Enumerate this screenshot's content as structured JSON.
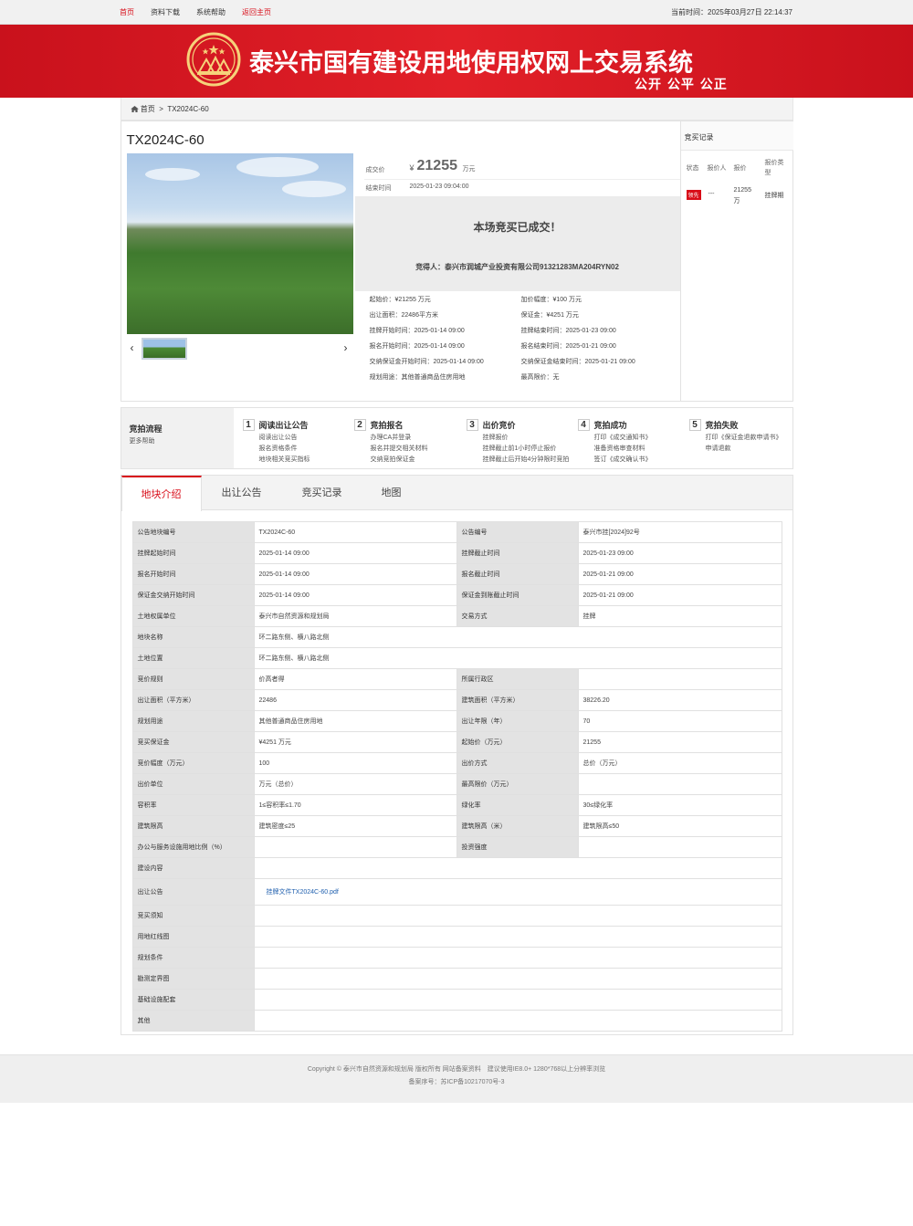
{
  "topbar": {
    "nav": [
      {
        "label": "首页",
        "active": true
      },
      {
        "label": "资料下载",
        "active": false
      },
      {
        "label": "系统帮助",
        "active": false
      },
      {
        "label": "返回主页",
        "active": true
      }
    ],
    "clock_label": "当前时间：",
    "clock_value": "2025年03月27日 22:14:37"
  },
  "banner": {
    "title": "泰兴市国有建设用地使用权网上交易系统",
    "slogan": "公开 公平 公正"
  },
  "breadcrumb": {
    "home": "首页",
    "sep": ">",
    "current": "TX2024C-60"
  },
  "lot": {
    "title": "TX2024C-60",
    "deal_price_label": "成交价",
    "currency": "¥",
    "deal_price": "21255",
    "deal_unit": "万元",
    "end_time_label": "结束时间",
    "end_time": "2025-01-23 09:04:00",
    "result_title": "本场竞买已成交！",
    "winner": "竞得人：泰兴市润城产业投资有限公司91321283MA204RYN02",
    "specs": [
      {
        "label": "起始价：",
        "value": "¥21255 万元"
      },
      {
        "label": "加价幅度：",
        "value": "¥100 万元"
      },
      {
        "label": "出让面积：",
        "value": "22486平方米"
      },
      {
        "label": "保证金：",
        "value": "¥4251 万元"
      },
      {
        "label": "挂牌开始时间：",
        "value": "2025-01-14 09:00"
      },
      {
        "label": "挂牌结束时间：",
        "value": "2025-01-23 09:00"
      },
      {
        "label": "报名开始时间：",
        "value": "2025-01-14 09:00"
      },
      {
        "label": "报名结束时间：",
        "value": "2025-01-21 09:00"
      },
      {
        "label": "交纳保证金开始时间：",
        "value": "2025-01-14 09:00"
      },
      {
        "label": "交纳保证金结束时间：",
        "value": "2025-01-21 09:00"
      },
      {
        "label": "规划用途：",
        "value": "其他普通商品住房用地"
      },
      {
        "label": "最高限价：",
        "value": "无"
      }
    ]
  },
  "bid_record": {
    "title": "竞买记录",
    "headers": [
      "状态",
      "报价人",
      "报价",
      "报价类型"
    ],
    "rows": [
      {
        "status": "领先",
        "bidder": "---",
        "price": "21255万",
        "type": "挂牌期"
      }
    ]
  },
  "flow": {
    "title": "竞拍流程",
    "help": "更多帮助",
    "steps": [
      {
        "num": "1",
        "title": "阅读出让公告",
        "items": [
          "阅读出让公告",
          "报名资格条件",
          "地块相关竞买指标"
        ]
      },
      {
        "num": "2",
        "title": "竞拍报名",
        "items": [
          "办理CA并登录",
          "报名并提交相关材料",
          "交纳竞拍保证金"
        ]
      },
      {
        "num": "3",
        "title": "出价竞价",
        "items": [
          "挂牌报价",
          "挂牌截止前1小时停止报价",
          "挂牌截止后开始4分钟限时竞拍"
        ]
      },
      {
        "num": "4",
        "title": "竞拍成功",
        "items": [
          "打印《成交通知书》",
          "准备资格审查材料",
          "签订《成交确认书》"
        ]
      },
      {
        "num": "5",
        "title": "竞拍失败",
        "items": [
          "打印《保证金退款申请书》",
          "申请退款"
        ]
      }
    ]
  },
  "tabs": [
    "地块介绍",
    "出让公告",
    "竞买记录",
    "地图"
  ],
  "info": {
    "r1": {
      "k1": "公告地块编号",
      "v1": "TX2024C-60",
      "k2": "公告编号",
      "v2": "泰兴市挂[2024]92号"
    },
    "r2": {
      "k1": "挂牌起始时间",
      "v1": "2025-01-14 09:00",
      "k2": "挂牌截止时间",
      "v2": "2025-01-23 09:00"
    },
    "r3": {
      "k1": "报名开始时间",
      "v1": "2025-01-14 09:00",
      "k2": "报名截止时间",
      "v2": "2025-01-21 09:00"
    },
    "r4": {
      "k1": "保证金交纳开始时间",
      "v1": "2025-01-14 09:00",
      "k2": "保证金到账截止时间",
      "v2": "2025-01-21 09:00"
    },
    "r5": {
      "k1": "土地权属单位",
      "v1": "泰兴市自然资源和规划局",
      "k2": "交易方式",
      "v2": "挂牌"
    },
    "r6": {
      "k1": "地块名称",
      "v1": "环二路东侧、横八路北侧"
    },
    "r7": {
      "k1": "土地位置",
      "v1": "环二路东侧、横八路北侧"
    },
    "r8": {
      "k1": "竞价规则",
      "v1": "价高者得",
      "k2": "所属行政区",
      "v2": ""
    },
    "r9": {
      "k1": "出让面积（平方米）",
      "v1": "22486",
      "k2": "建筑面积（平方米）",
      "v2": "38226.20"
    },
    "r10": {
      "k1": "规划用途",
      "v1": "其他普通商品住房用地",
      "k2": "出让年限（年）",
      "v2": "70"
    },
    "r11": {
      "k1": "竞买保证金",
      "v1": "¥4251 万元",
      "k2": "起始价（万元）",
      "v2": "21255"
    },
    "r12": {
      "k1": "竞价幅度（万元）",
      "v1": "100",
      "k2": "出价方式",
      "v2": "总价（万元）"
    },
    "r13": {
      "k1": "出价单位",
      "v1": "万元（总价）",
      "k2": "最高限价（万元）",
      "v2": ""
    },
    "r14": {
      "k1": "容积率",
      "v1": "1≤容积率≤1.70",
      "k2": "绿化率",
      "v2": "30≤绿化率"
    },
    "r15": {
      "k1": "建筑限高",
      "v1": "建筑密度≤25",
      "k2": "建筑限高（米）",
      "v2": "建筑限高≤50"
    },
    "r16": {
      "k1": "办公与服务设施用地比例（%）",
      "v1": "",
      "k2": "投资强度",
      "v2": ""
    },
    "r17": {
      "k1": "建设内容",
      "v1": ""
    },
    "r18": {
      "k1": "出让公告",
      "v1": "挂牌文件TX2024C-60.pdf"
    },
    "r19": {
      "k1": "竞买须知",
      "v1": ""
    },
    "r20": {
      "k1": "用地红线图",
      "v1": ""
    },
    "r21": {
      "k1": "规划条件",
      "v1": ""
    },
    "r22": {
      "k1": "勘测定界图",
      "v1": ""
    },
    "r23": {
      "k1": "基础设施配套",
      "v1": ""
    },
    "r24": {
      "k1": "其他",
      "v1": ""
    }
  },
  "footer": {
    "line1": "Copyright © 泰兴市自然资源和规划局 版权所有 网站备案资料　建议使用IE8.0+ 1280*768以上分辨率浏览",
    "line2": "备案序号：苏ICP备10217070号-3"
  },
  "colors": {
    "brand_red": "#d80c18",
    "link_blue": "#1f5fae"
  }
}
